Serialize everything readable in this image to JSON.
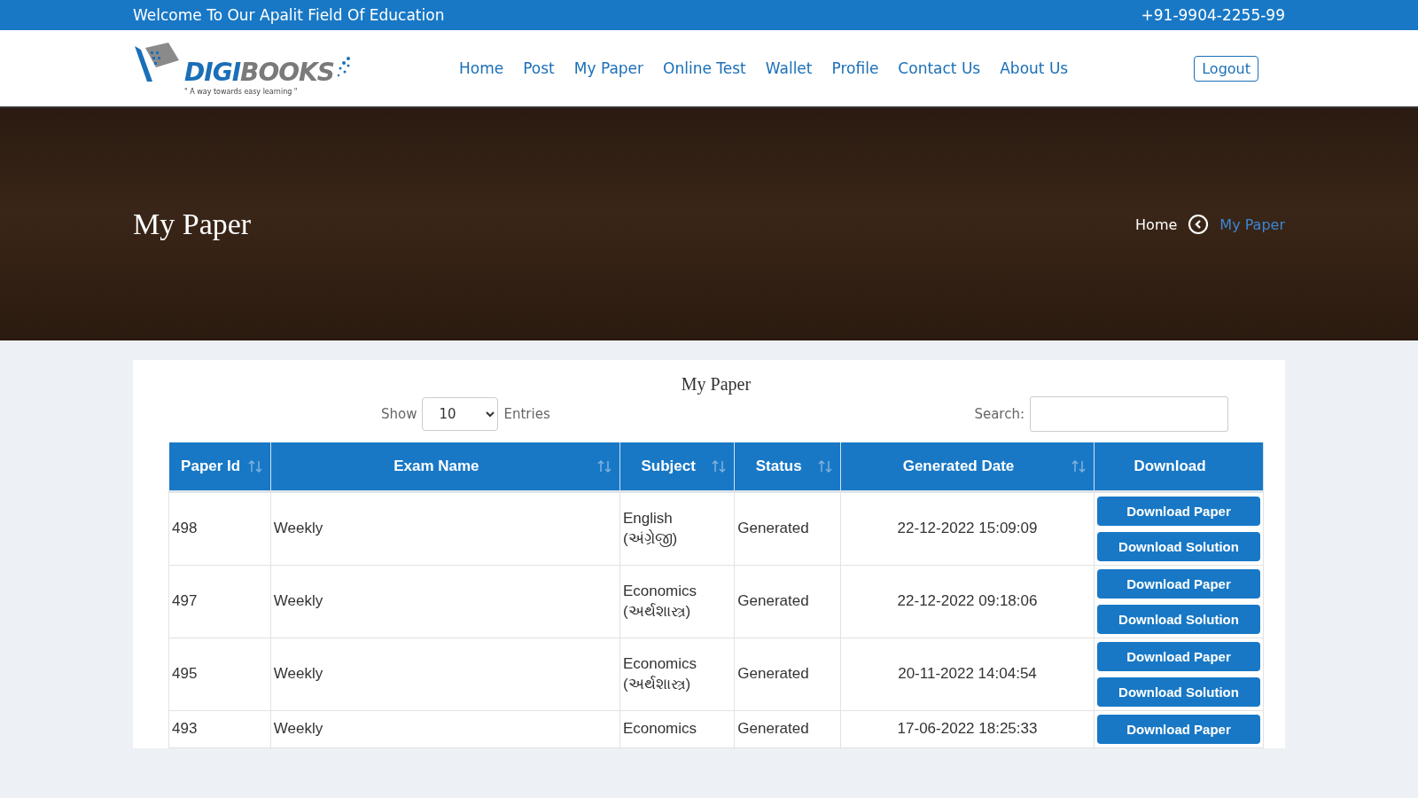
{
  "top_bar": {
    "welcome": "Welcome To Our Apalit Field Of Education",
    "phone": "+91-9904-2255-99"
  },
  "logo": {
    "name_part1": "DIGI",
    "name_part2": "BOOKS",
    "tagline": "\" A way towards easy learning \""
  },
  "nav": {
    "items": [
      "Home",
      "Post",
      "My Paper",
      "Online Test",
      "Wallet",
      "Profile",
      "Contact Us",
      "About Us"
    ],
    "logout": "Logout"
  },
  "hero": {
    "title": "My Paper",
    "breadcrumb": {
      "home": "Home",
      "current": "My Paper"
    }
  },
  "card": {
    "title": "My Paper",
    "show_label": "Show",
    "page_size": "10",
    "entries_label": "Entries",
    "search_label": "Search:"
  },
  "table": {
    "columns": [
      {
        "label": "Paper Id",
        "sortable": true
      },
      {
        "label": "Exam Name",
        "sortable": true
      },
      {
        "label": "Subject",
        "sortable": true
      },
      {
        "label": "Status",
        "sortable": true
      },
      {
        "label": "Generated Date",
        "sortable": true
      },
      {
        "label": "Download",
        "sortable": false
      }
    ],
    "rows": [
      {
        "id": "498",
        "exam": "Weekly",
        "subject": "English",
        "subject_local": "(અંગ્રેજી)",
        "status": "Generated",
        "date": "22-12-2022 15:09:09",
        "buttons": [
          "Download Paper",
          "Download Solution"
        ]
      },
      {
        "id": "497",
        "exam": "Weekly",
        "subject": "Economics",
        "subject_local": "(અર્થશાસ્ત્ર)",
        "status": "Generated",
        "date": "22-12-2022 09:18:06",
        "buttons": [
          "Download Paper",
          "Download Solution"
        ]
      },
      {
        "id": "495",
        "exam": "Weekly",
        "subject": "Economics",
        "subject_local": "(અર્થશાસ્ત્ર)",
        "status": "Generated",
        "date": "20-11-2022 14:04:54",
        "buttons": [
          "Download Paper",
          "Download Solution"
        ]
      },
      {
        "id": "493",
        "exam": "Weekly",
        "subject": "Economics",
        "status": "Generated",
        "date": "17-06-2022 18:25:33",
        "buttons": [
          "Download Paper"
        ]
      }
    ]
  }
}
